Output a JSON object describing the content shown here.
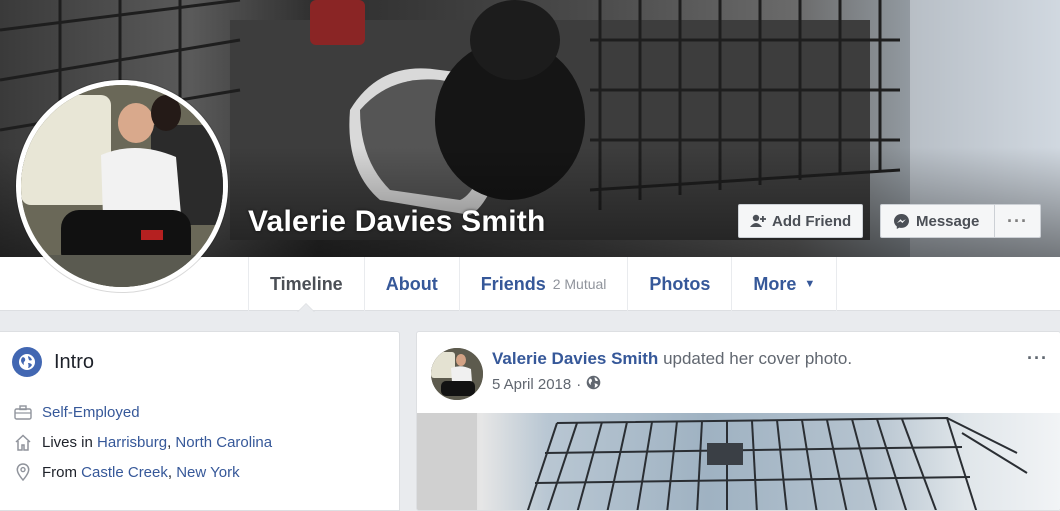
{
  "profile": {
    "name": "Valerie Davies Smith"
  },
  "actions": {
    "add_friend": "Add Friend",
    "message": "Message",
    "more_dots": "···"
  },
  "tabs": [
    {
      "label": "Timeline",
      "sub": ""
    },
    {
      "label": "About",
      "sub": ""
    },
    {
      "label": "Friends",
      "sub": "2 Mutual"
    },
    {
      "label": "Photos",
      "sub": ""
    },
    {
      "label": "More",
      "sub": ""
    }
  ],
  "intro": {
    "title": "Intro",
    "work": "Self-Employed",
    "lives_prefix": "Lives in",
    "lives_city": "Harrisburg",
    "lives_state": "North Carolina",
    "from_prefix": "From",
    "from_city": "Castle Creek",
    "from_state": "New York",
    "comma": ","
  },
  "post": {
    "author": "Valerie Davies Smith",
    "action": "updated her cover photo.",
    "date": "5 April 2018",
    "separator": "·",
    "more_dots": "···"
  },
  "colors": {
    "link": "#365899",
    "brand": "#4267b2",
    "background": "#e9ebee"
  }
}
